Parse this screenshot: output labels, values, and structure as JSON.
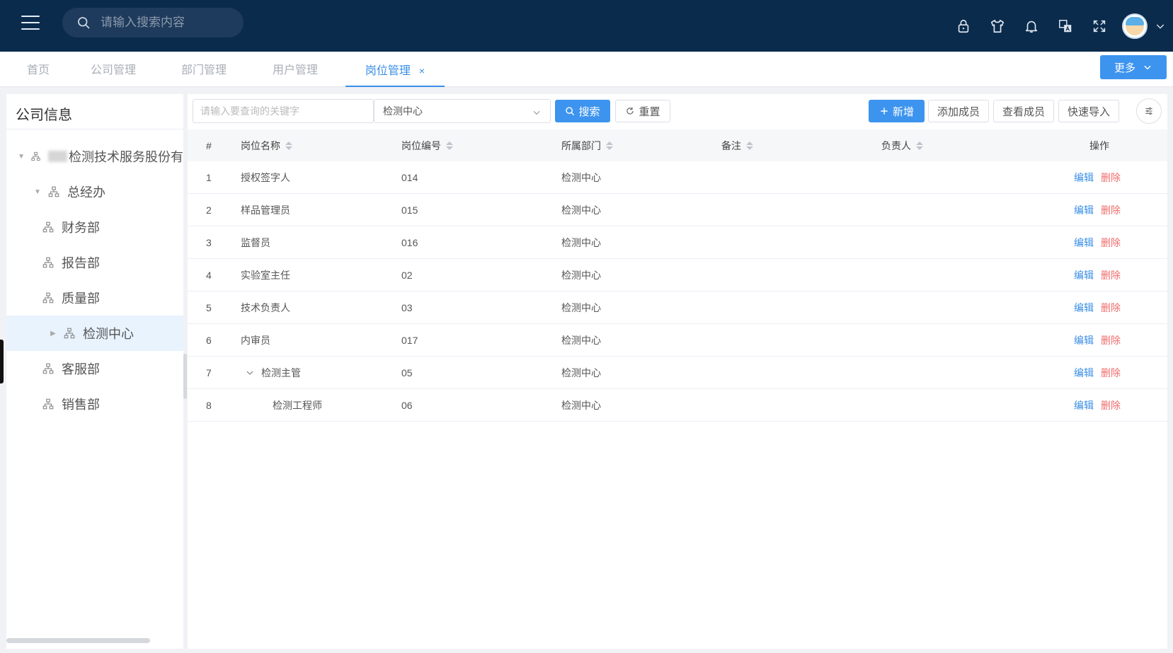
{
  "header": {
    "search_placeholder": "请输入搜索内容"
  },
  "tabs": [
    {
      "label": "首页"
    },
    {
      "label": "公司管理"
    },
    {
      "label": "部门管理"
    },
    {
      "label": "用户管理"
    },
    {
      "label": "岗位管理",
      "close": "×"
    }
  ],
  "more_button": {
    "label": "更多"
  },
  "left": {
    "title": "公司信息",
    "tree": [
      {
        "label": "检测技术服务股份有"
      },
      {
        "label": "总经办"
      },
      {
        "label": "财务部"
      },
      {
        "label": "报告部"
      },
      {
        "label": "质量部"
      },
      {
        "label": "检测中心"
      },
      {
        "label": "客服部"
      },
      {
        "label": "销售部"
      }
    ]
  },
  "toolbar": {
    "keyword_placeholder": "请输入要查询的关键字",
    "dept_selected": "检测中心",
    "search_label": "搜索",
    "reset_label": "重置",
    "add_label": "新增",
    "add_member_label": "添加成员",
    "view_member_label": "查看成员",
    "quick_import_label": "快速导入"
  },
  "table": {
    "columns": [
      "#",
      "岗位名称",
      "岗位编号",
      "所属部门",
      "备注",
      "负责人",
      "操作"
    ],
    "rows": [
      {
        "idx": "1",
        "name": "授权签字人",
        "code": "014",
        "dept": "检测中心",
        "note": "",
        "owner": ""
      },
      {
        "idx": "2",
        "name": "样品管理员",
        "code": "015",
        "dept": "检测中心",
        "note": "",
        "owner": ""
      },
      {
        "idx": "3",
        "name": "监督员",
        "code": "016",
        "dept": "检测中心",
        "note": "",
        "owner": ""
      },
      {
        "idx": "4",
        "name": "实验室主任",
        "code": "02",
        "dept": "检测中心",
        "note": "",
        "owner": ""
      },
      {
        "idx": "5",
        "name": "技术负责人",
        "code": "03",
        "dept": "检测中心",
        "note": "",
        "owner": ""
      },
      {
        "idx": "6",
        "name": "内审员",
        "code": "017",
        "dept": "检测中心",
        "note": "",
        "owner": ""
      },
      {
        "idx": "7",
        "name": "检测主管",
        "code": "05",
        "dept": "检测中心",
        "note": "",
        "owner": ""
      },
      {
        "idx": "8",
        "name": "检测工程师",
        "code": "06",
        "dept": "检测中心",
        "note": "",
        "owner": ""
      }
    ],
    "edit_label": "编辑",
    "delete_label": "删除"
  },
  "colors": {
    "header_bg": "#0b2b4c",
    "accent": "#3d94ee",
    "danger": "#f06b6b"
  }
}
